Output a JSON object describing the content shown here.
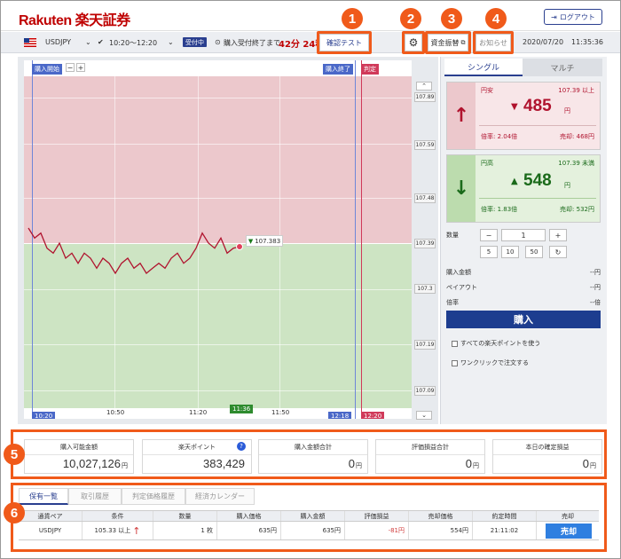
{
  "header": {
    "logo": "Rakuten 楽天証券",
    "logout_label": "ログアウト",
    "logout_icon": "exit-icon"
  },
  "subbar": {
    "pair": "USDJPY",
    "session": "10:20～12:20",
    "status_badge": "受付中",
    "deadline_label": "購入受付終了まで",
    "countdown": "42分 24秒",
    "date": "2020/07/20",
    "time": "11:35:36"
  },
  "toolbar": {
    "confirm_test": "確認テスト",
    "settings_icon": "gear-icon",
    "fund_transfer": "資金振替",
    "notices": "お知らせ"
  },
  "callouts": [
    "1",
    "2",
    "3",
    "4",
    "5",
    "6"
  ],
  "chart_data": {
    "type": "line",
    "title": "",
    "xlabel": "",
    "ylabel": "",
    "x_ticks": [
      "10:20",
      "10:50",
      "11:20",
      "11:36",
      "11:50",
      "12:18",
      "12:20"
    ],
    "y_ticks": [
      107.89,
      107.59,
      107.48,
      107.39,
      107.3,
      107.19,
      107.09
    ],
    "ylim": [
      107.05,
      107.95
    ],
    "strike": 107.39,
    "current_label": "107.383",
    "markers": {
      "start": "購入開始",
      "end": "購入終了",
      "judge": "判定"
    },
    "series": [
      {
        "values": [
          107.42,
          107.4,
          107.41,
          107.38,
          107.37,
          107.39,
          107.36,
          107.37,
          107.35,
          107.37,
          107.36,
          107.34,
          107.36,
          107.35,
          107.33,
          107.35,
          107.36,
          107.34,
          107.35,
          107.33,
          107.34,
          107.35,
          107.34,
          107.36,
          107.37,
          107.35,
          107.36,
          107.38,
          107.41,
          107.39,
          107.38,
          107.4,
          107.37,
          107.38,
          107.383
        ]
      }
    ],
    "zoom_in": "+",
    "zoom_out": "−"
  },
  "panel": {
    "tabs": [
      "シングル",
      "マルチ"
    ],
    "up": {
      "label": "円安",
      "threshold": "107.39 以上",
      "price": "485",
      "unit": "円",
      "odds": "倍率: 2.04倍",
      "sell": "売却: 468円"
    },
    "down": {
      "label": "円高",
      "threshold": "107.39 未満",
      "price": "548",
      "unit": "円",
      "odds": "倍率: 1.83倍",
      "sell": "売却: 532円"
    },
    "qty_label": "数量",
    "qty_value": "1",
    "qty_minus": "−",
    "qty_plus": "+",
    "qty_presets": [
      "5",
      "10",
      "50"
    ],
    "reset_icon": "refresh-icon",
    "rows": [
      {
        "label": "購入金額",
        "value": "--円"
      },
      {
        "label": "ペイアウト",
        "value": "--円"
      },
      {
        "label": "倍率",
        "value": "--倍"
      }
    ],
    "buy_label": "購入",
    "use_points": "すべての楽天ポイントを使う",
    "one_click": "ワンクリックで注文する"
  },
  "summary": [
    {
      "title": "購入可能金額",
      "value": "10,027,126",
      "unit": "円"
    },
    {
      "title": "楽天ポイント",
      "value": "383,429",
      "unit": ""
    },
    {
      "title": "購入金額合計",
      "value": "0",
      "unit": "円"
    },
    {
      "title": "評価損益合計",
      "value": "0",
      "unit": "円"
    },
    {
      "title": "本日の確定損益",
      "value": "0",
      "unit": "円"
    }
  ],
  "table": {
    "tabs": [
      "保有一覧",
      "取引履歴",
      "判定価格履歴",
      "経済カレンダー"
    ],
    "headers": [
      "通貨ペア",
      "条件",
      "数量",
      "購入価格",
      "購入金額",
      "評価損益",
      "売却価格",
      "約定時間",
      "売却"
    ],
    "row": {
      "pair": "USDJPY",
      "cond": "105.33 以上",
      "qty": "1 枚",
      "price": "635円",
      "amount": "635円",
      "pl": "-81円",
      "sell_price": "554円",
      "time": "21:11:02",
      "action": "売却"
    }
  }
}
